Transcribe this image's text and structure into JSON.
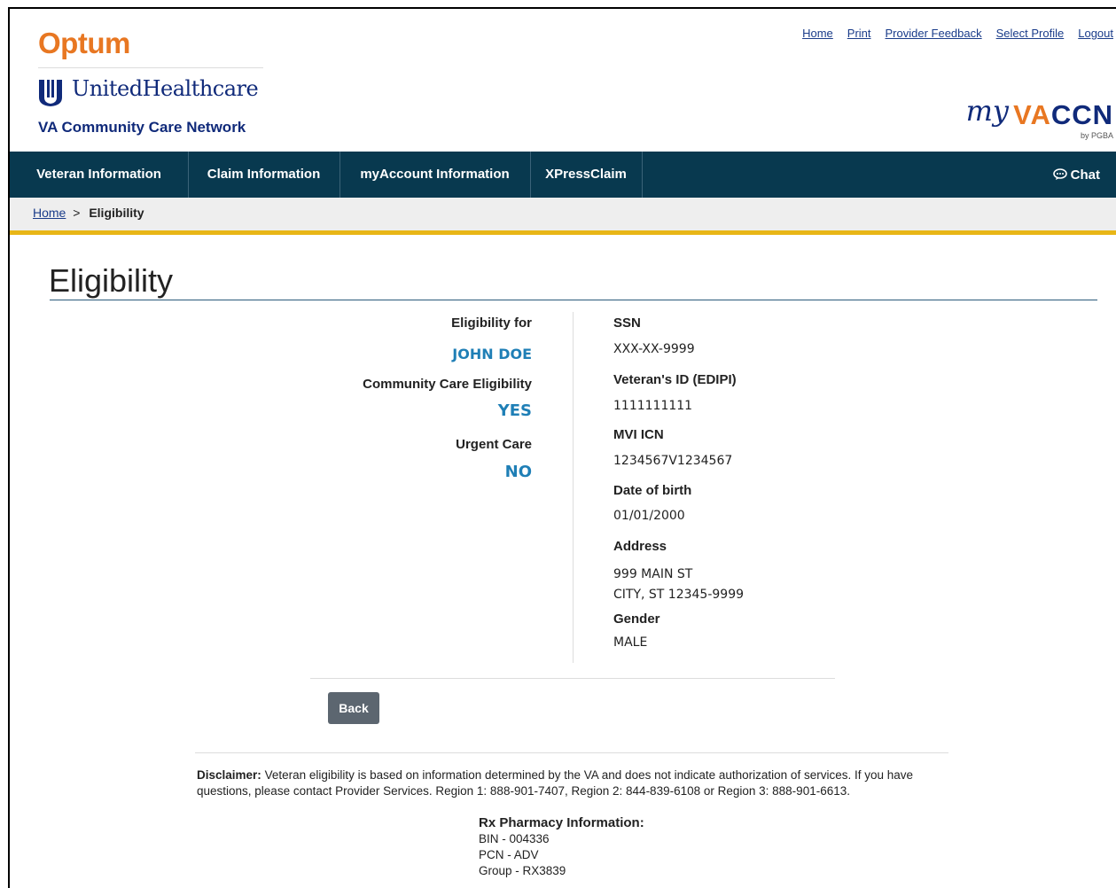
{
  "header": {
    "optum_logo": "Optum",
    "uhc_logo": "UnitedHealthcare",
    "network_name": "VA Community Care Network",
    "top_links": [
      "Home",
      "Print",
      "Provider Feedback",
      "Select Profile",
      "Logout"
    ],
    "brand": {
      "my": "my",
      "vaccn_orange": "VA",
      "vaccn_blue": "CCN",
      "by": "by PGBA"
    }
  },
  "nav": {
    "items": [
      "Veteran Information",
      "Claim Information",
      "myAccount Information",
      "XPressClaim"
    ],
    "chat_label": "Chat"
  },
  "breadcrumb": {
    "home": "Home",
    "separator": ">",
    "current": "Eligibility"
  },
  "page_title": "Eligibility",
  "eligibility": {
    "for_label": "Eligibility for",
    "name": "JOHN DOE",
    "community_care_label": "Community Care Eligibility",
    "community_care_value": "YES",
    "urgent_care_label": "Urgent Care",
    "urgent_care_value": "NO"
  },
  "details": {
    "ssn_label": "SSN",
    "ssn": "XXX-XX-9999",
    "edipi_label": "Veteran's ID (EDIPI)",
    "edipi": "1111111111",
    "mvi_label": "MVI ICN",
    "mvi": "1234567V1234567",
    "dob_label": "Date of birth",
    "dob": "01/01/2000",
    "address_label": "Address",
    "address_line1": "999 MAIN ST",
    "address_line2": "CITY, ST 12345-9999",
    "gender_label": "Gender",
    "gender": "MALE"
  },
  "back_button": "Back",
  "disclaimer": {
    "label": "Disclaimer:",
    "text": "Veteran eligibility is based on information determined by the VA and does not indicate authorization of services. If you have questions, please contact Provider Services. Region 1: 888-901-7407, Region 2: 844-839-6108 or Region 3: 888-901-6613."
  },
  "rx": {
    "heading": "Rx Pharmacy Information:",
    "bin": "BIN - 004336",
    "pcn": "PCN - ADV",
    "group": "Group - RX3839"
  },
  "colors": {
    "orange": "#e87722",
    "navy": "#102a7a",
    "nav_bg": "#08394f",
    "accent_blue": "#1f7fb6",
    "gold": "#e8b617"
  }
}
